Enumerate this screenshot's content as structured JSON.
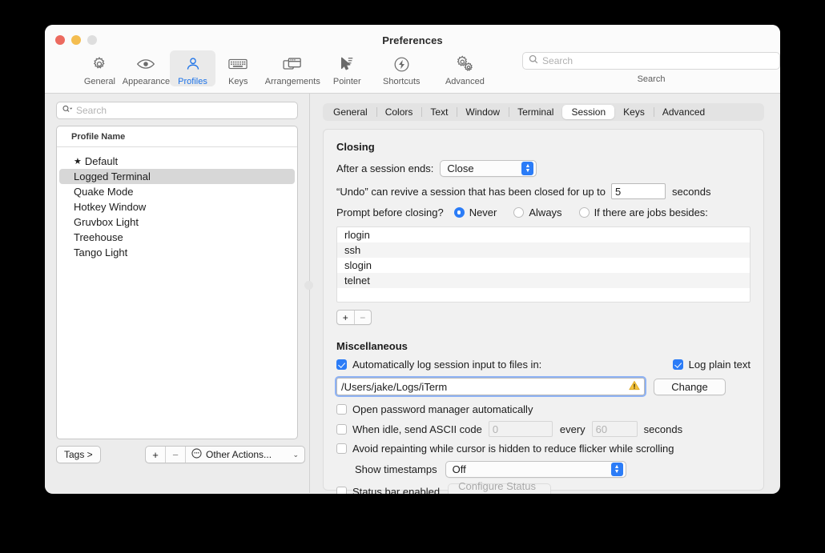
{
  "window": {
    "title": "Preferences"
  },
  "toolbar": {
    "items": [
      {
        "label": "General",
        "icon": "gear-icon"
      },
      {
        "label": "Appearance",
        "icon": "eye-icon"
      },
      {
        "label": "Profiles",
        "icon": "person-icon",
        "selected": true
      },
      {
        "label": "Keys",
        "icon": "keyboard-icon"
      },
      {
        "label": "Arrangements",
        "icon": "windows-icon"
      },
      {
        "label": "Pointer",
        "icon": "cursor-icon"
      },
      {
        "label": "Shortcuts",
        "icon": "bolt-circle-icon"
      },
      {
        "label": "Advanced",
        "icon": "double-gear-icon"
      }
    ],
    "search_placeholder": "Search",
    "search_value": "",
    "search_label": "Search"
  },
  "sidebar": {
    "search_placeholder": "Search",
    "search_value": "",
    "column_header": "Profile Name",
    "profiles": [
      {
        "name": "Default",
        "default": true,
        "selected": false,
        "star": "★"
      },
      {
        "name": "Logged Terminal",
        "default": false,
        "selected": true
      },
      {
        "name": "Quake Mode",
        "default": false,
        "selected": false
      },
      {
        "name": "Hotkey Window",
        "default": false,
        "selected": false
      },
      {
        "name": "Gruvbox Light",
        "default": false,
        "selected": false
      },
      {
        "name": "Treehouse",
        "default": false,
        "selected": false
      },
      {
        "name": "Tango Light",
        "default": false,
        "selected": false
      }
    ],
    "tags_button": "Tags >",
    "add_button": "+",
    "remove_button": "−",
    "other_actions": "Other Actions...",
    "other_actions_chevron": "⌄"
  },
  "tabs": [
    {
      "label": "General",
      "selected": false
    },
    {
      "label": "Colors",
      "selected": false
    },
    {
      "label": "Text",
      "selected": false
    },
    {
      "label": "Window",
      "selected": false
    },
    {
      "label": "Terminal",
      "selected": false
    },
    {
      "label": "Session",
      "selected": true
    },
    {
      "label": "Keys",
      "selected": false
    },
    {
      "label": "Advanced",
      "selected": false
    }
  ],
  "session": {
    "closing": {
      "title": "Closing",
      "after_session_ends_label": "After a session ends:",
      "after_session_ends_value": "Close",
      "undo_prefix": "“Undo” can revive a session that has been closed for up to",
      "undo_seconds_value": "5",
      "undo_suffix": "seconds",
      "prompt_label": "Prompt before closing?",
      "prompt_options": [
        {
          "label": "Never",
          "selected": true
        },
        {
          "label": "Always",
          "selected": false
        },
        {
          "label": "If there are jobs besides:",
          "selected": false
        }
      ],
      "jobs": [
        "rlogin",
        "ssh",
        "slogin",
        "telnet"
      ],
      "job_add": "+",
      "job_remove": "−"
    },
    "miscellaneous": {
      "title": "Miscellaneous",
      "auto_log_label": "Automatically log session input to files in:",
      "auto_log_checked": true,
      "log_plain_text_label": "Log plain text",
      "log_plain_text_checked": true,
      "log_path_value": "/Users/jake/Logs/iTerm",
      "log_path_warning_icon": "warning-triangle-icon",
      "change_button": "Change",
      "password_manager_label": "Open password manager automatically",
      "password_manager_checked": false,
      "idle_label": "When idle, send ASCII code",
      "idle_checked": false,
      "idle_code_value": "0",
      "idle_every_label": "every",
      "idle_interval_value": "60",
      "idle_seconds_label": "seconds",
      "avoid_repaint_label": "Avoid repainting while cursor is hidden to reduce flicker while scrolling",
      "avoid_repaint_checked": false,
      "timestamps_label": "Show timestamps",
      "timestamps_value": "Off",
      "status_bar_label": "Status bar enabled",
      "status_bar_checked": false,
      "configure_status_bar_button": "Configure Status Bar"
    }
  },
  "colors": {
    "accent": "#2b7cf7",
    "selected_tab_text": "#1b72e8",
    "warning": "#f5c33b"
  }
}
